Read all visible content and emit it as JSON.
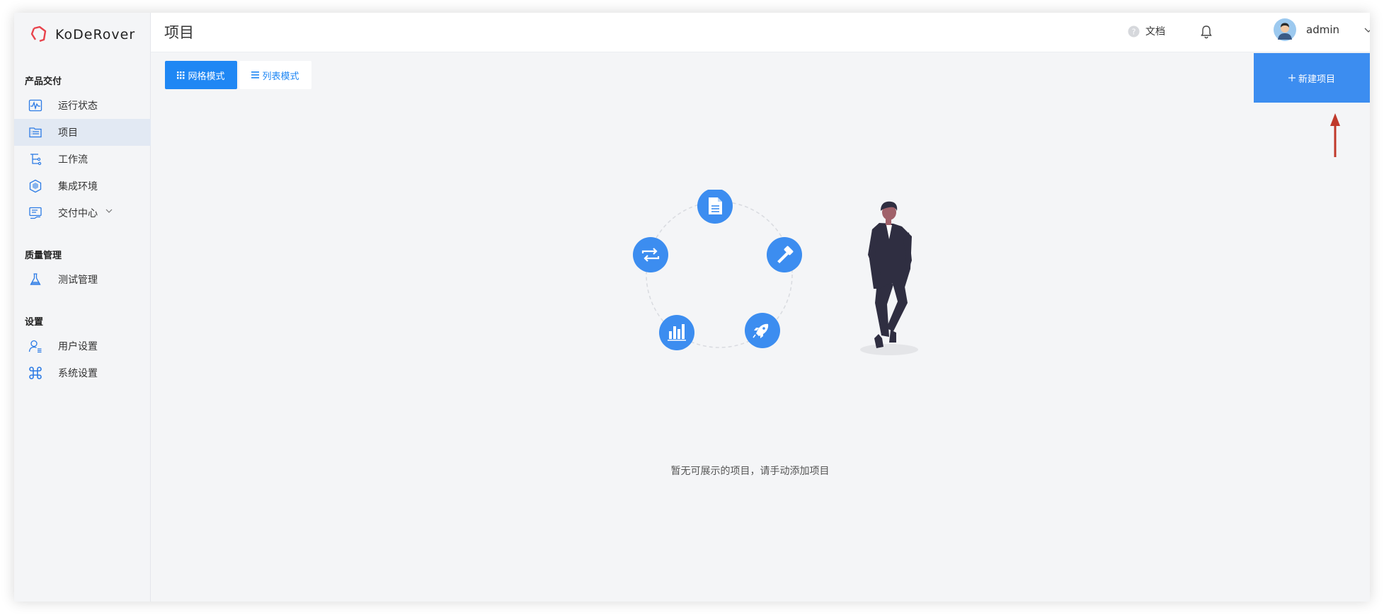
{
  "app": {
    "logo_text": "KoDeRover"
  },
  "sidebar": {
    "sections": [
      {
        "title": "产品交付"
      },
      {
        "title": "质量管理"
      },
      {
        "title": "设置"
      }
    ],
    "items": [
      {
        "label": "运行状态",
        "icon": "monitor-wave-icon",
        "active": false
      },
      {
        "label": "项目",
        "icon": "project-folder-icon",
        "active": true
      },
      {
        "label": "工作流",
        "icon": "workflow-icon",
        "active": false
      },
      {
        "label": "集成环境",
        "icon": "environment-cube-icon",
        "active": false
      },
      {
        "label": "交付中心",
        "icon": "delivery-center-icon",
        "active": false,
        "has_submenu": true
      },
      {
        "label": "测试管理",
        "icon": "flask-icon",
        "active": false
      },
      {
        "label": "用户设置",
        "icon": "user-settings-icon",
        "active": false
      },
      {
        "label": "系统设置",
        "icon": "command-icon",
        "active": false
      }
    ]
  },
  "header": {
    "title": "项目",
    "docs_label": "文档",
    "user_name": "admin"
  },
  "toolbar": {
    "grid_mode_label": "网格模式",
    "list_mode_label": "列表模式",
    "new_project_label": "新建项目"
  },
  "empty_state": {
    "message": "暂无可展示的项目，请手动添加项目"
  },
  "colors": {
    "primary": "#1f87f4",
    "new_button": "#3c8df0",
    "annotation_arrow": "#c0392b",
    "active_nav_bg": "#e2e9f3"
  }
}
